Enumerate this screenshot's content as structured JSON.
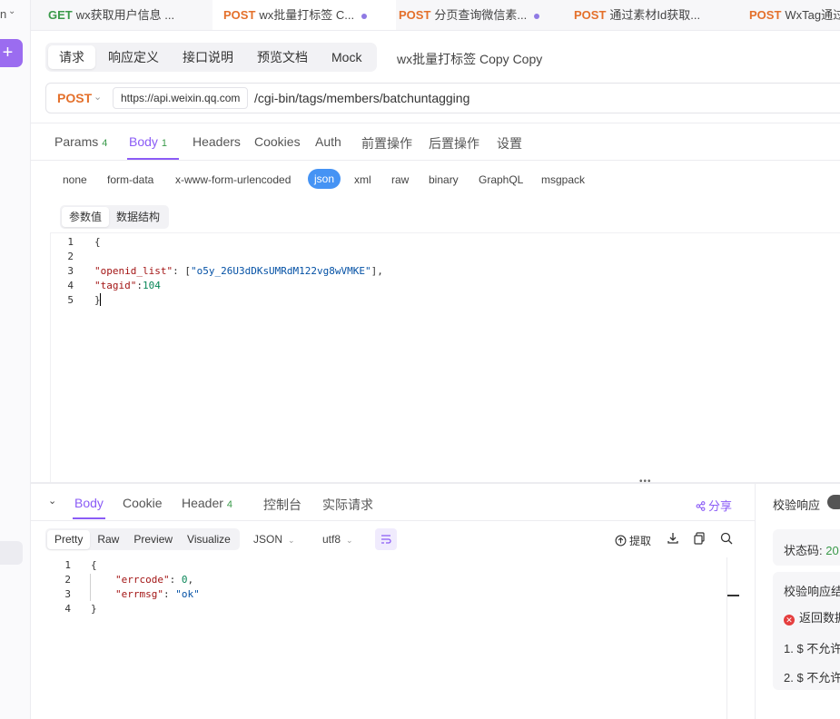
{
  "left": {
    "label": "n",
    "plus": "+"
  },
  "tabs": [
    {
      "method": "GET",
      "title": "wx获取用户信息 ...",
      "dot": false
    },
    {
      "method": "POST",
      "title": "wx批量打标签 C...",
      "dot": true
    },
    {
      "method": "POST",
      "title": "分页查询微信素...",
      "dot": true
    },
    {
      "method": "POST",
      "title": "通过素材Id获取...",
      "dot": false
    },
    {
      "method": "POST",
      "title": "WxTag通过",
      "dot": false
    }
  ],
  "request_tabs": [
    "请求",
    "响应定义",
    "接口说明",
    "预览文档",
    "Mock"
  ],
  "request_name": "wx批量打标签 Copy Copy",
  "url": {
    "method": "POST",
    "base": "https://api.weixin.qq.com",
    "path": "/cgi-bin/tags/members/batchuntagging"
  },
  "param_tabs": [
    {
      "label": "Params",
      "count": "4"
    },
    {
      "label": "Body",
      "count": "1"
    },
    {
      "label": "Headers",
      "count": ""
    },
    {
      "label": "Cookies",
      "count": ""
    },
    {
      "label": "Auth",
      "count": ""
    },
    {
      "label": "前置操作",
      "count": ""
    },
    {
      "label": "后置操作",
      "count": ""
    },
    {
      "label": "设置",
      "count": ""
    }
  ],
  "body_types": [
    "none",
    "form-data",
    "x-www-form-urlencoded",
    "json",
    "xml",
    "raw",
    "binary",
    "GraphQL",
    "msgpack"
  ],
  "body_subtabs": [
    "参数值",
    "数据结构"
  ],
  "request_body": {
    "line_numbers": [
      "1",
      "2",
      "3",
      "4",
      "5"
    ],
    "l1": "{",
    "l3_key": "\"openid_list\"",
    "l3_sep": ": [",
    "l3_val": "\"o5y_26U3dDKsUMRdM122vg8wVMKE\"",
    "l3_end": "],",
    "l4_key": "\"tagid\"",
    "l4_sep": ":",
    "l4_val": "104",
    "l5": "}"
  },
  "response_tabs": [
    {
      "label": "Body",
      "count": ""
    },
    {
      "label": "Cookie",
      "count": ""
    },
    {
      "label": "Header",
      "count": "4"
    },
    {
      "label": "控制台",
      "count": ""
    },
    {
      "label": "实际请求",
      "count": ""
    }
  ],
  "share_label": "分享",
  "format_tabs": [
    "Pretty",
    "Raw",
    "Preview",
    "Visualize"
  ],
  "format_select": "JSON",
  "encoding_select": "utf8",
  "extract_label": "提取",
  "response_body": {
    "line_numbers": [
      "1",
      "2",
      "3",
      "4"
    ],
    "l1": "{",
    "l2_key": "\"errcode\"",
    "l2_sep": ": ",
    "l2_val": "0",
    "l2_end": ",",
    "l3_key": "\"errmsg\"",
    "l3_sep": ": ",
    "l3_val": "\"ok\"",
    "l4": "}"
  },
  "validation": {
    "title": "校验响应",
    "status_label": "状态码: ",
    "status_value": "20",
    "section": "校验响应结",
    "error": "返回数据",
    "item1": "1. $ 不允许",
    "item2": "2. $ 不允许"
  },
  "colors": {
    "accent": "#8b5cf6",
    "post": "#e4702b",
    "get": "#3a9a4a",
    "json_pill": "#4593f4"
  }
}
